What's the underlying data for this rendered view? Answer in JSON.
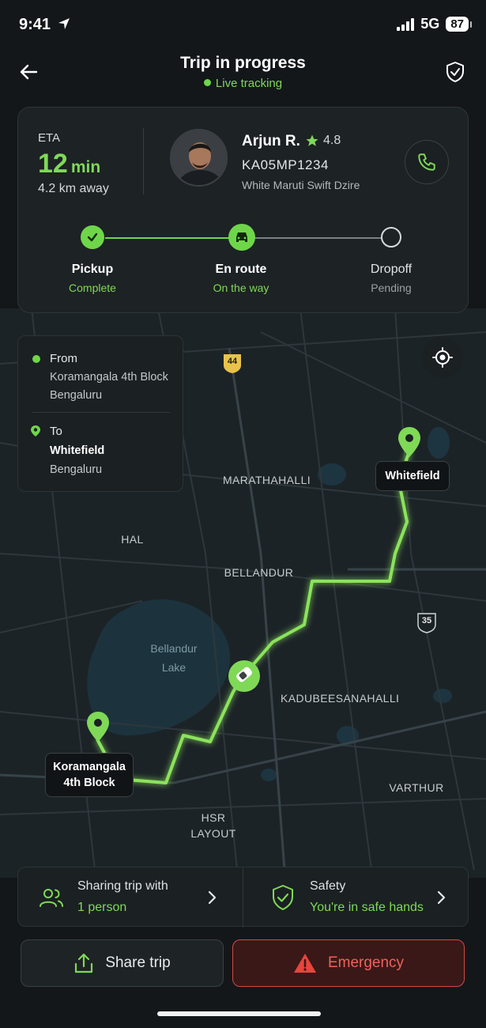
{
  "status_bar": {
    "time": "9:41",
    "network": "5G",
    "battery": "87"
  },
  "header": {
    "title": "Trip in progress",
    "subtitle": "Live tracking"
  },
  "trip_card": {
    "eta_label": "ETA",
    "eta_value": "12",
    "eta_unit": "min",
    "distance": "4.2 km away",
    "driver": {
      "name": "Arjun R.",
      "rating": "4.8",
      "plate": "KA05MP1234",
      "car": "White Maruti Swift Dzire"
    },
    "steps": [
      {
        "label": "Pickup",
        "status": "Complete"
      },
      {
        "label": "En route",
        "status": "On the way"
      },
      {
        "label": "Dropoff",
        "status": "Pending"
      }
    ]
  },
  "route": {
    "from_label": "From",
    "from_line1": "Koramangala 4th Block",
    "from_line2": "Bengaluru",
    "to_label": "To",
    "to_line1": "Whitefield",
    "to_line2": "Bengaluru"
  },
  "map": {
    "labels": {
      "marathahalli": "MARATHAHALLI",
      "hal": "HAL",
      "bellandur": "BELLANDUR",
      "bellandur_lake_1": "Bellandur",
      "bellandur_lake_2": "Lake",
      "kadubeesanahalli": "KADUBEESANAHALLI",
      "varthur": "VARTHUR",
      "hsr_1": "HSR",
      "hsr_2": "LAYOUT"
    },
    "highway_a": "44",
    "highway_b": "35",
    "pin_dest": "Whitefield",
    "pin_origin_1": "Koramangala",
    "pin_origin_2": "4th Block"
  },
  "info": {
    "sharing_title": "Sharing trip with",
    "sharing_value": "1 person",
    "safety_title": "Safety",
    "safety_value": "You're in safe hands"
  },
  "buttons": {
    "share": "Share trip",
    "emergency": "Emergency"
  },
  "colors": {
    "accent": "#7fd957",
    "danger": "#f0615a",
    "background": "#131719"
  }
}
